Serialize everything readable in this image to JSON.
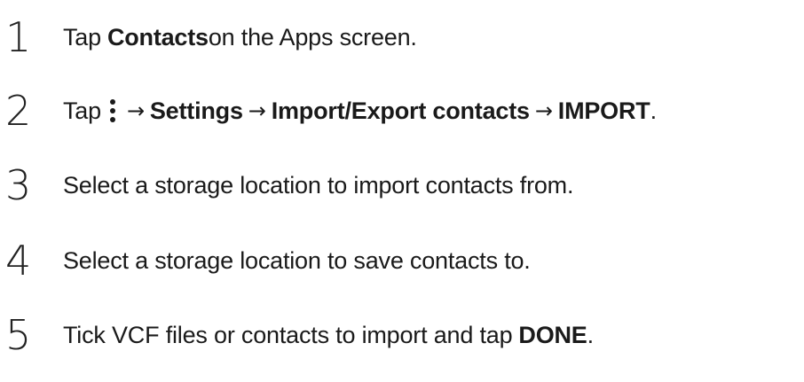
{
  "steps": [
    {
      "number": "1",
      "parts": [
        "Tap ",
        "Contacts",
        " on the Apps screen."
      ]
    },
    {
      "number": "2",
      "parts": [
        "Tap",
        "→",
        "Settings",
        "→",
        "Import/Export contacts",
        "→",
        "IMPORT",
        "."
      ],
      "icons": [
        "more-options-icon"
      ]
    },
    {
      "number": "3",
      "text": "Select a storage location to import contacts from."
    },
    {
      "number": "4",
      "text": "Select a storage location to save contacts to."
    },
    {
      "number": "5",
      "parts": [
        "Tick VCF files or contacts to import and tap ",
        "DONE",
        "."
      ]
    }
  ]
}
